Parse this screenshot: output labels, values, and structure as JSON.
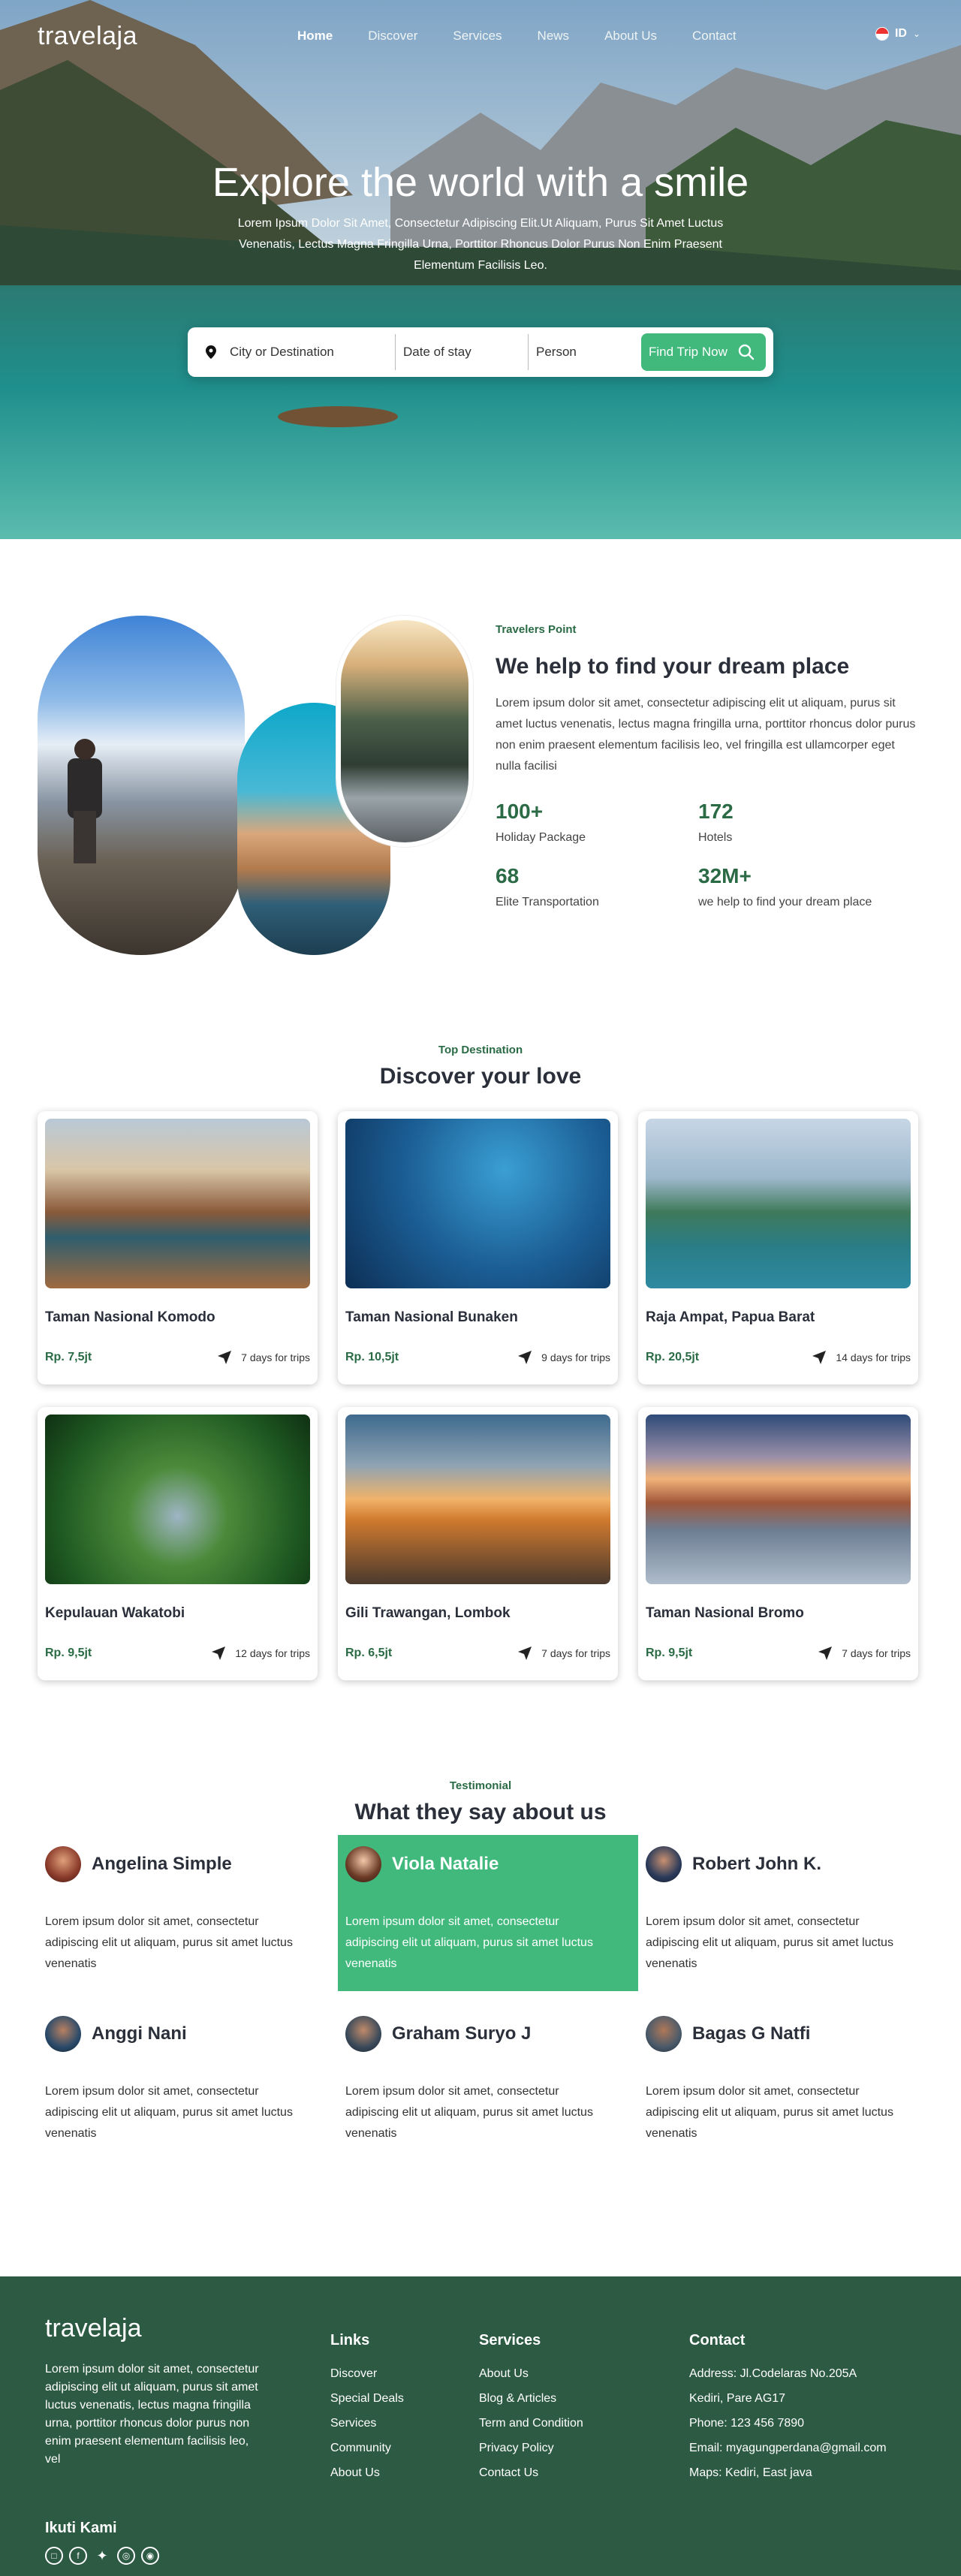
{
  "nav": {
    "logo": "travelaja",
    "items": [
      {
        "label": "Home",
        "active": true
      },
      {
        "label": "Discover",
        "active": false
      },
      {
        "label": "Services",
        "active": false
      },
      {
        "label": "News",
        "active": false
      },
      {
        "label": "About Us",
        "active": false
      },
      {
        "label": "Contact",
        "active": false
      }
    ],
    "language": "ID"
  },
  "hero": {
    "title": "Explore the world with a smile",
    "subtitle": "Lorem Ipsum Dolor Sit Amet, Consectetur Adipiscing Elit.Ut Aliquam, Purus Sit Amet Luctus Venenatis, Lectus Magna Fringilla Urna, Porttitor Rhoncus Dolor Purus Non Enim Praesent Elementum Facilisis Leo.",
    "search": {
      "destination_placeholder": "City or Destination",
      "date_placeholder": "Date of stay",
      "person_placeholder": "Person",
      "button_label": "Find Trip Now"
    }
  },
  "about": {
    "eyebrow": "Travelers Point",
    "heading": "We help to find your dream place",
    "body": "Lorem ipsum dolor sit amet, consectetur adipiscing elit ut aliquam, purus sit amet luctus venenatis, lectus magna fringilla urna, porttitor rhoncus dolor purus non enim praesent elementum facilisis leo, vel fringilla est ullamcorper eget nulla facilisi",
    "stats": [
      {
        "value": "100+",
        "label": "Holiday Package"
      },
      {
        "value": "172",
        "label": "Hotels"
      },
      {
        "value": "68",
        "label": "Elite Transportation"
      },
      {
        "value": "32M+",
        "label": "we help to find your dream place"
      }
    ]
  },
  "destinations": {
    "eyebrow": "Top Destination",
    "heading": "Discover your love",
    "cards": [
      {
        "name": "Taman Nasional Komodo",
        "price": "Rp. 7,5jt",
        "days": "7 days for trips"
      },
      {
        "name": "Taman Nasional Bunaken",
        "price": "Rp. 10,5jt",
        "days": "9 days for trips"
      },
      {
        "name": "Raja Ampat, Papua Barat",
        "price": "Rp. 20,5jt",
        "days": "14 days for trips"
      },
      {
        "name": "Kepulauan Wakatobi",
        "price": "Rp. 9,5jt",
        "days": "12 days for trips"
      },
      {
        "name": "Gili Trawangan, Lombok",
        "price": "Rp. 6,5jt",
        "days": "7 days for trips"
      },
      {
        "name": "Taman Nasional Bromo",
        "price": "Rp. 9,5jt",
        "days": "7 days for trips"
      }
    ]
  },
  "testimonials": {
    "eyebrow": "Testimonial",
    "heading": "What they say about us",
    "items": [
      {
        "name": "Angelina Simple",
        "text": "Lorem ipsum dolor sit amet, consectetur adipiscing elit ut aliquam, purus sit amet luctus venenatis",
        "highlighted": false
      },
      {
        "name": "Viola Natalie",
        "text": "Lorem ipsum dolor sit amet, consectetur adipiscing elit ut aliquam, purus sit amet luctus venenatis",
        "highlighted": true
      },
      {
        "name": "Robert John K.",
        "text": "Lorem ipsum dolor sit amet, consectetur adipiscing elit ut aliquam, purus sit amet luctus venenatis",
        "highlighted": false
      },
      {
        "name": "Anggi Nani",
        "text": "Lorem ipsum dolor sit amet, consectetur adipiscing elit ut aliquam, purus sit amet luctus venenatis",
        "highlighted": false
      },
      {
        "name": "Graham Suryo J",
        "text": "Lorem ipsum dolor sit amet, consectetur adipiscing elit ut aliquam, purus sit amet luctus venenatis",
        "highlighted": false
      },
      {
        "name": "Bagas G Natfi",
        "text": "Lorem ipsum dolor sit amet, consectetur adipiscing elit ut aliquam, purus sit amet luctus venenatis",
        "highlighted": false
      }
    ]
  },
  "footer": {
    "logo": "travelaja",
    "about": "Lorem ipsum dolor sit amet, consectetur adipiscing elit ut aliquam, purus sit amet luctus venenatis, lectus magna fringilla urna, porttitor rhoncus dolor purus non enim praesent elementum facilisis leo, vel",
    "follow_label": "Ikuti Kami",
    "social": [
      "instagram-icon",
      "facebook-icon",
      "twitter-icon",
      "dribbble-icon",
      "github-icon"
    ],
    "links": {
      "title": "Links",
      "items": [
        "Discover",
        "Special Deals",
        "Services",
        "Community",
        "About Us"
      ]
    },
    "services": {
      "title": "Services",
      "items": [
        "About Us",
        "Blog & Articles",
        "Term and Condition",
        "Privacy Policy",
        "Contact Us"
      ]
    },
    "contact": {
      "title": "Contact",
      "items": [
        "Address: Jl.Codelaras No.205A",
        "Kediri, Pare AG17",
        "Phone: 123 456 7890",
        "Email: myagungperdana@gmail.com",
        "Maps: Kediri, East java"
      ]
    }
  },
  "colors": {
    "accent": "#41b97c",
    "dark_green": "#2a6b45",
    "footer_bg": "#2c5a43"
  }
}
